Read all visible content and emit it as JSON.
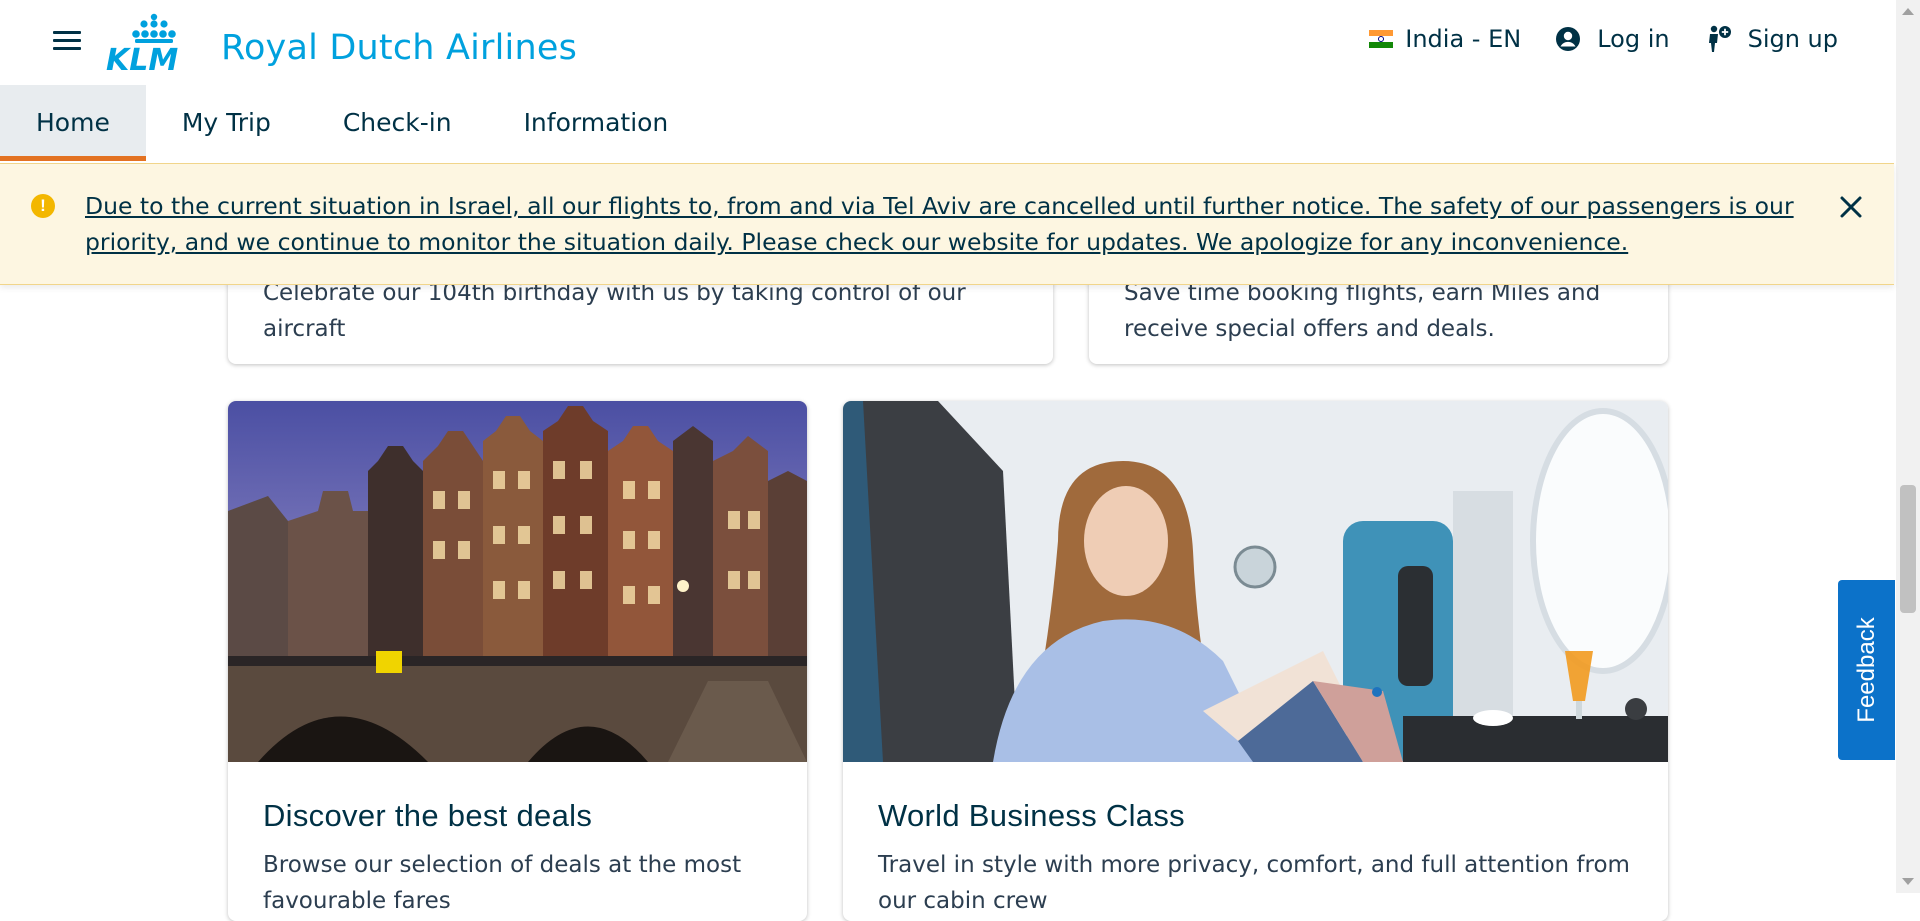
{
  "header": {
    "logo_wordmark": "KLM",
    "logo_text": "Royal Dutch Airlines",
    "region_label": "India - EN",
    "login_label": "Log in",
    "signup_label": "Sign up"
  },
  "nav": {
    "tabs": [
      {
        "label": "Home",
        "active": true
      },
      {
        "label": "My Trip"
      },
      {
        "label": "Check-in"
      },
      {
        "label": "Information"
      }
    ]
  },
  "alert": {
    "message": "Due to the current situation in Israel, all our flights to, from and via Tel Aviv are cancelled until further notice. The safety of our passengers is our priority, and we continue to monitor the situation daily. Please check our website for updates. We apologize for any inconvenience.",
    "icon": "warning-icon",
    "close_icon": "close-icon"
  },
  "cards_top": [
    {
      "text": "Celebrate our 104th birthday with us by taking control of our aircraft"
    },
    {
      "text": "Save time booking flights, earn Miles and receive special offers and deals."
    }
  ],
  "cards": [
    {
      "title": "Discover the best deals",
      "description": "Browse our selection of deals at the most favourable fares"
    },
    {
      "title": "World Business Class",
      "description": "Travel in style with more privacy, comfort, and full attention from our cabin crew"
    }
  ],
  "feedback_label": "Feedback",
  "colors": {
    "brand_blue": "#00a1de",
    "dark_navy": "#003145",
    "active_tab_underline": "#e37222",
    "alert_bg": "#fdf6e1",
    "feedback_bg": "#0c72c9"
  }
}
